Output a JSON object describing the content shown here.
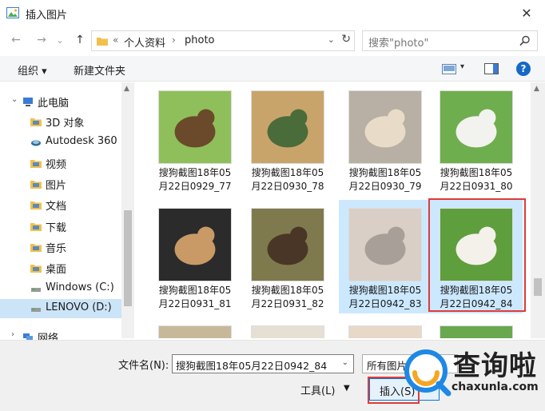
{
  "window": {
    "title": "插入图片",
    "close_glyph": "✕"
  },
  "nav": {
    "back_glyph": "←",
    "forward_glyph": "→",
    "recent_glyph": "⌄",
    "up_glyph": "↑",
    "address": {
      "overflow": "«",
      "crumbs": [
        "个人资料",
        "photo"
      ],
      "separator": "›",
      "dropdown_glyph": "⌄",
      "refresh_glyph": "↻"
    },
    "search_placeholder": "搜索\"photo\""
  },
  "toolbar": {
    "organize": "组织 ▾",
    "new_folder": "新建文件夹",
    "view_dropdown_glyph": "▾",
    "help": "?"
  },
  "sidebar": {
    "items": [
      {
        "label": "此电脑",
        "icon": "computer-icon",
        "level": 0,
        "expander": "⌄",
        "selected": false
      },
      {
        "label": "3D 对象",
        "icon": "folder-3d-icon",
        "level": 1,
        "expander": "",
        "selected": false
      },
      {
        "label": "Autodesk 360",
        "icon": "cloud-icon",
        "level": 1,
        "expander": "",
        "selected": false
      },
      {
        "label": "视频",
        "icon": "video-folder-icon",
        "level": 1,
        "expander": "",
        "selected": false
      },
      {
        "label": "图片",
        "icon": "pictures-folder-icon",
        "level": 1,
        "expander": "",
        "selected": false
      },
      {
        "label": "文档",
        "icon": "documents-folder-icon",
        "level": 1,
        "expander": "",
        "selected": false
      },
      {
        "label": "下载",
        "icon": "downloads-folder-icon",
        "level": 1,
        "expander": "",
        "selected": false
      },
      {
        "label": "音乐",
        "icon": "music-folder-icon",
        "level": 1,
        "expander": "",
        "selected": false
      },
      {
        "label": "桌面",
        "icon": "desktop-folder-icon",
        "level": 1,
        "expander": "",
        "selected": false
      },
      {
        "label": "Windows (C:)",
        "icon": "drive-icon",
        "level": 1,
        "expander": "",
        "selected": false
      },
      {
        "label": "LENOVO (D:)",
        "icon": "drive-icon",
        "level": 1,
        "expander": "",
        "selected": true
      },
      {
        "label": "网络",
        "icon": "network-icon",
        "level": 0,
        "expander": "›",
        "selected": false
      }
    ],
    "scroll_up_glyph": "▲",
    "scroll_down_glyph": "▼"
  },
  "files": [
    {
      "line1": "搜狗截图18年05",
      "line2": "月22日0929_77",
      "selected": false,
      "highlighted": false,
      "colors": [
        "#8fbf5a",
        "#6a4a2a"
      ]
    },
    {
      "line1": "搜狗截图18年05",
      "line2": "月22日0930_78",
      "selected": false,
      "highlighted": false,
      "colors": [
        "#c9a46a",
        "#4a6b3a"
      ]
    },
    {
      "line1": "搜狗截图18年05",
      "line2": "月22日0930_79",
      "selected": false,
      "highlighted": false,
      "colors": [
        "#b8b0a4",
        "#e8dcc8"
      ]
    },
    {
      "line1": "搜狗截图18年05",
      "line2": "月22日0931_80",
      "selected": false,
      "highlighted": false,
      "colors": [
        "#6fae4e",
        "#f2f2ee"
      ]
    },
    {
      "line1": "搜狗截图18年05",
      "line2": "月22日0931_81",
      "selected": false,
      "highlighted": false,
      "colors": [
        "#2b2b2b",
        "#c99a66"
      ]
    },
    {
      "line1": "搜狗截图18年05",
      "line2": "月22日0931_82",
      "selected": false,
      "highlighted": false,
      "colors": [
        "#7f7a4e",
        "#4a3626"
      ]
    },
    {
      "line1": "搜狗截图18年05",
      "line2": "月22日0942_83",
      "selected": true,
      "highlighted": false,
      "colors": [
        "#d9cfc6",
        "#a89f98"
      ]
    },
    {
      "line1": "搜狗截图18年05",
      "line2": "月22日0942_84",
      "selected": true,
      "highlighted": true,
      "colors": [
        "#5f9e3c",
        "#f4f0ea"
      ]
    },
    {
      "line1": "",
      "line2": "",
      "selected": false,
      "highlighted": false,
      "colors": [
        "#c8b89a",
        "#8f7a5a"
      ]
    },
    {
      "line1": "",
      "line2": "",
      "selected": false,
      "highlighted": false,
      "colors": [
        "#e6e0d4",
        "#b9a98a"
      ]
    },
    {
      "line1": "",
      "line2": "",
      "selected": false,
      "highlighted": false,
      "colors": [
        "#e8d8c8",
        "#c0a890"
      ]
    },
    {
      "line1": "",
      "line2": "",
      "selected": false,
      "highlighted": false,
      "colors": [
        "#6aa84f",
        "#dcd8d0"
      ]
    }
  ],
  "bottom": {
    "filename_label": "文件名(N):",
    "filename_value": "搜狗截图18年05月22日0942_84",
    "filename_dropdown_glyph": "⌄",
    "filetype_value": "所有图片",
    "tools_label": "工具(L)",
    "tools_dropdown_glyph": "▼",
    "insert_label": "插入(S)"
  },
  "watermark": {
    "text": "查询啦",
    "url": "chaxunla.com",
    "colors": [
      "#1e88e5",
      "#f5a623"
    ]
  },
  "colors": {
    "accent": "#0078d7",
    "selection": "#cce8ff",
    "highlight_box": "#e03a3a"
  }
}
